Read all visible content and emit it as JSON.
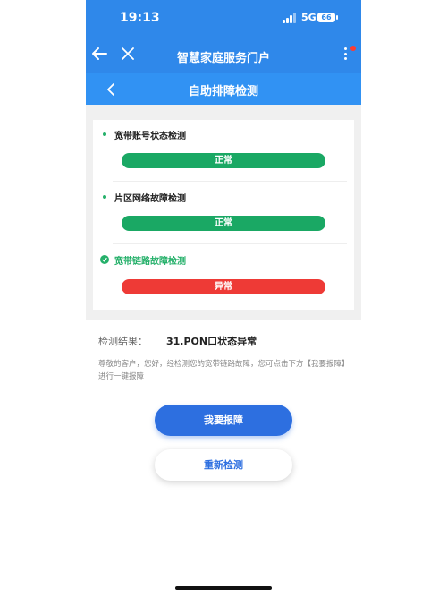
{
  "status_bar": {
    "time": "19:13",
    "network": "5G",
    "battery": "66"
  },
  "app_bar": {
    "title": "智慧家庭服务门户"
  },
  "sub_bar": {
    "title": "自助排障检测"
  },
  "checks": [
    {
      "label": "宽带账号状态检测",
      "status": "正常",
      "state": "ok"
    },
    {
      "label": "片区网络故障检测",
      "status": "正常",
      "state": "ok"
    },
    {
      "label": "宽带链路故障检测",
      "status": "异常",
      "state": "error"
    }
  ],
  "result": {
    "label": "检测结果：",
    "value": "31.PON口状态异常",
    "description": "尊敬的客户，您好，经检测您的宽带链路故障，您可点击下方【我要报障】进行一键报障"
  },
  "buttons": {
    "report": "我要报障",
    "retest": "重新检测"
  },
  "colors": {
    "primary": "#2f88ea",
    "success": "#1aa864",
    "error": "#ee3a36",
    "button": "#2d6fe0"
  }
}
